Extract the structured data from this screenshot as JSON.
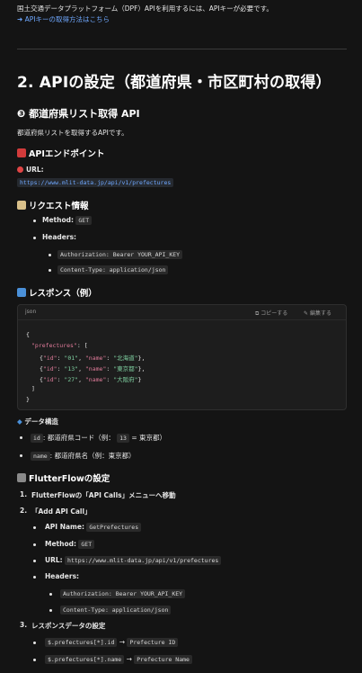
{
  "intro": {
    "line1": "国土交通データプラットフォーム（DPF）APIを利用するには、APIキーが必要です。",
    "link": "➜ APIキーの取得方法はこちら"
  },
  "section_title": "2. APIの設定（都道府県・市区町村の取得）",
  "sub_title": "❸ 都道府県リスト取得 API",
  "sub_desc": "都道府県リストを取得するAPIです。",
  "endpoint": {
    "heading": "APIエンドポイント",
    "url_label": "URL:",
    "url": "https://www.mlit-data.jp/api/v1/prefectures"
  },
  "request": {
    "heading": "リクエスト情報",
    "method_label": "Method:",
    "method": "GET",
    "headers_label": "Headers:",
    "headers": [
      "Authorization: Bearer YOUR_API_KEY",
      "Content-Type: application/json"
    ]
  },
  "response": {
    "heading": "レスポンス（例）",
    "lang": "json",
    "copy": "コピーする",
    "edit": "編集する",
    "code_open": "{",
    "code_key": "\"prefectures\"",
    "code_after_key": ": [",
    "rows": [
      {
        "id": "\"01\"",
        "name": "\"北海道\""
      },
      {
        "id": "\"13\"",
        "name": "\"東京都\""
      },
      {
        "id": "\"27\"",
        "name": "\"大阪府\""
      }
    ],
    "code_close_arr": "]",
    "code_close": "}"
  },
  "structure": {
    "heading": "データ構造",
    "items": [
      {
        "code": "id",
        "text": ": 都道府県コード（例：",
        "code2": "13",
        "text2": "= 東京都）"
      },
      {
        "code": "name",
        "text": ": 都道府県名（例：東京都）"
      }
    ]
  },
  "flutterflow": {
    "heading": "FlutterFlowの設定",
    "steps": [
      "FlutterFlowの「API Calls」メニューへ移動",
      "「Add API Call」",
      "レスポンスデータの設定"
    ],
    "api_name_label": "API Name:",
    "api_name": "GetPrefectures",
    "method_label": "Method:",
    "method": "GET",
    "url_label": "URL:",
    "url": "https://www.mlit-data.jp/api/v1/prefectures",
    "headers_label": "Headers:",
    "headers": [
      "Authorization: Bearer YOUR_API_KEY",
      "Content-Type: application/json"
    ],
    "mappings": [
      {
        "path": "$.prefectures[*].id",
        "arrow": "→",
        "target": "Prefecture ID"
      },
      {
        "path": "$.prefectures[*].name",
        "arrow": "→",
        "target": "Prefecture Name"
      }
    ]
  }
}
